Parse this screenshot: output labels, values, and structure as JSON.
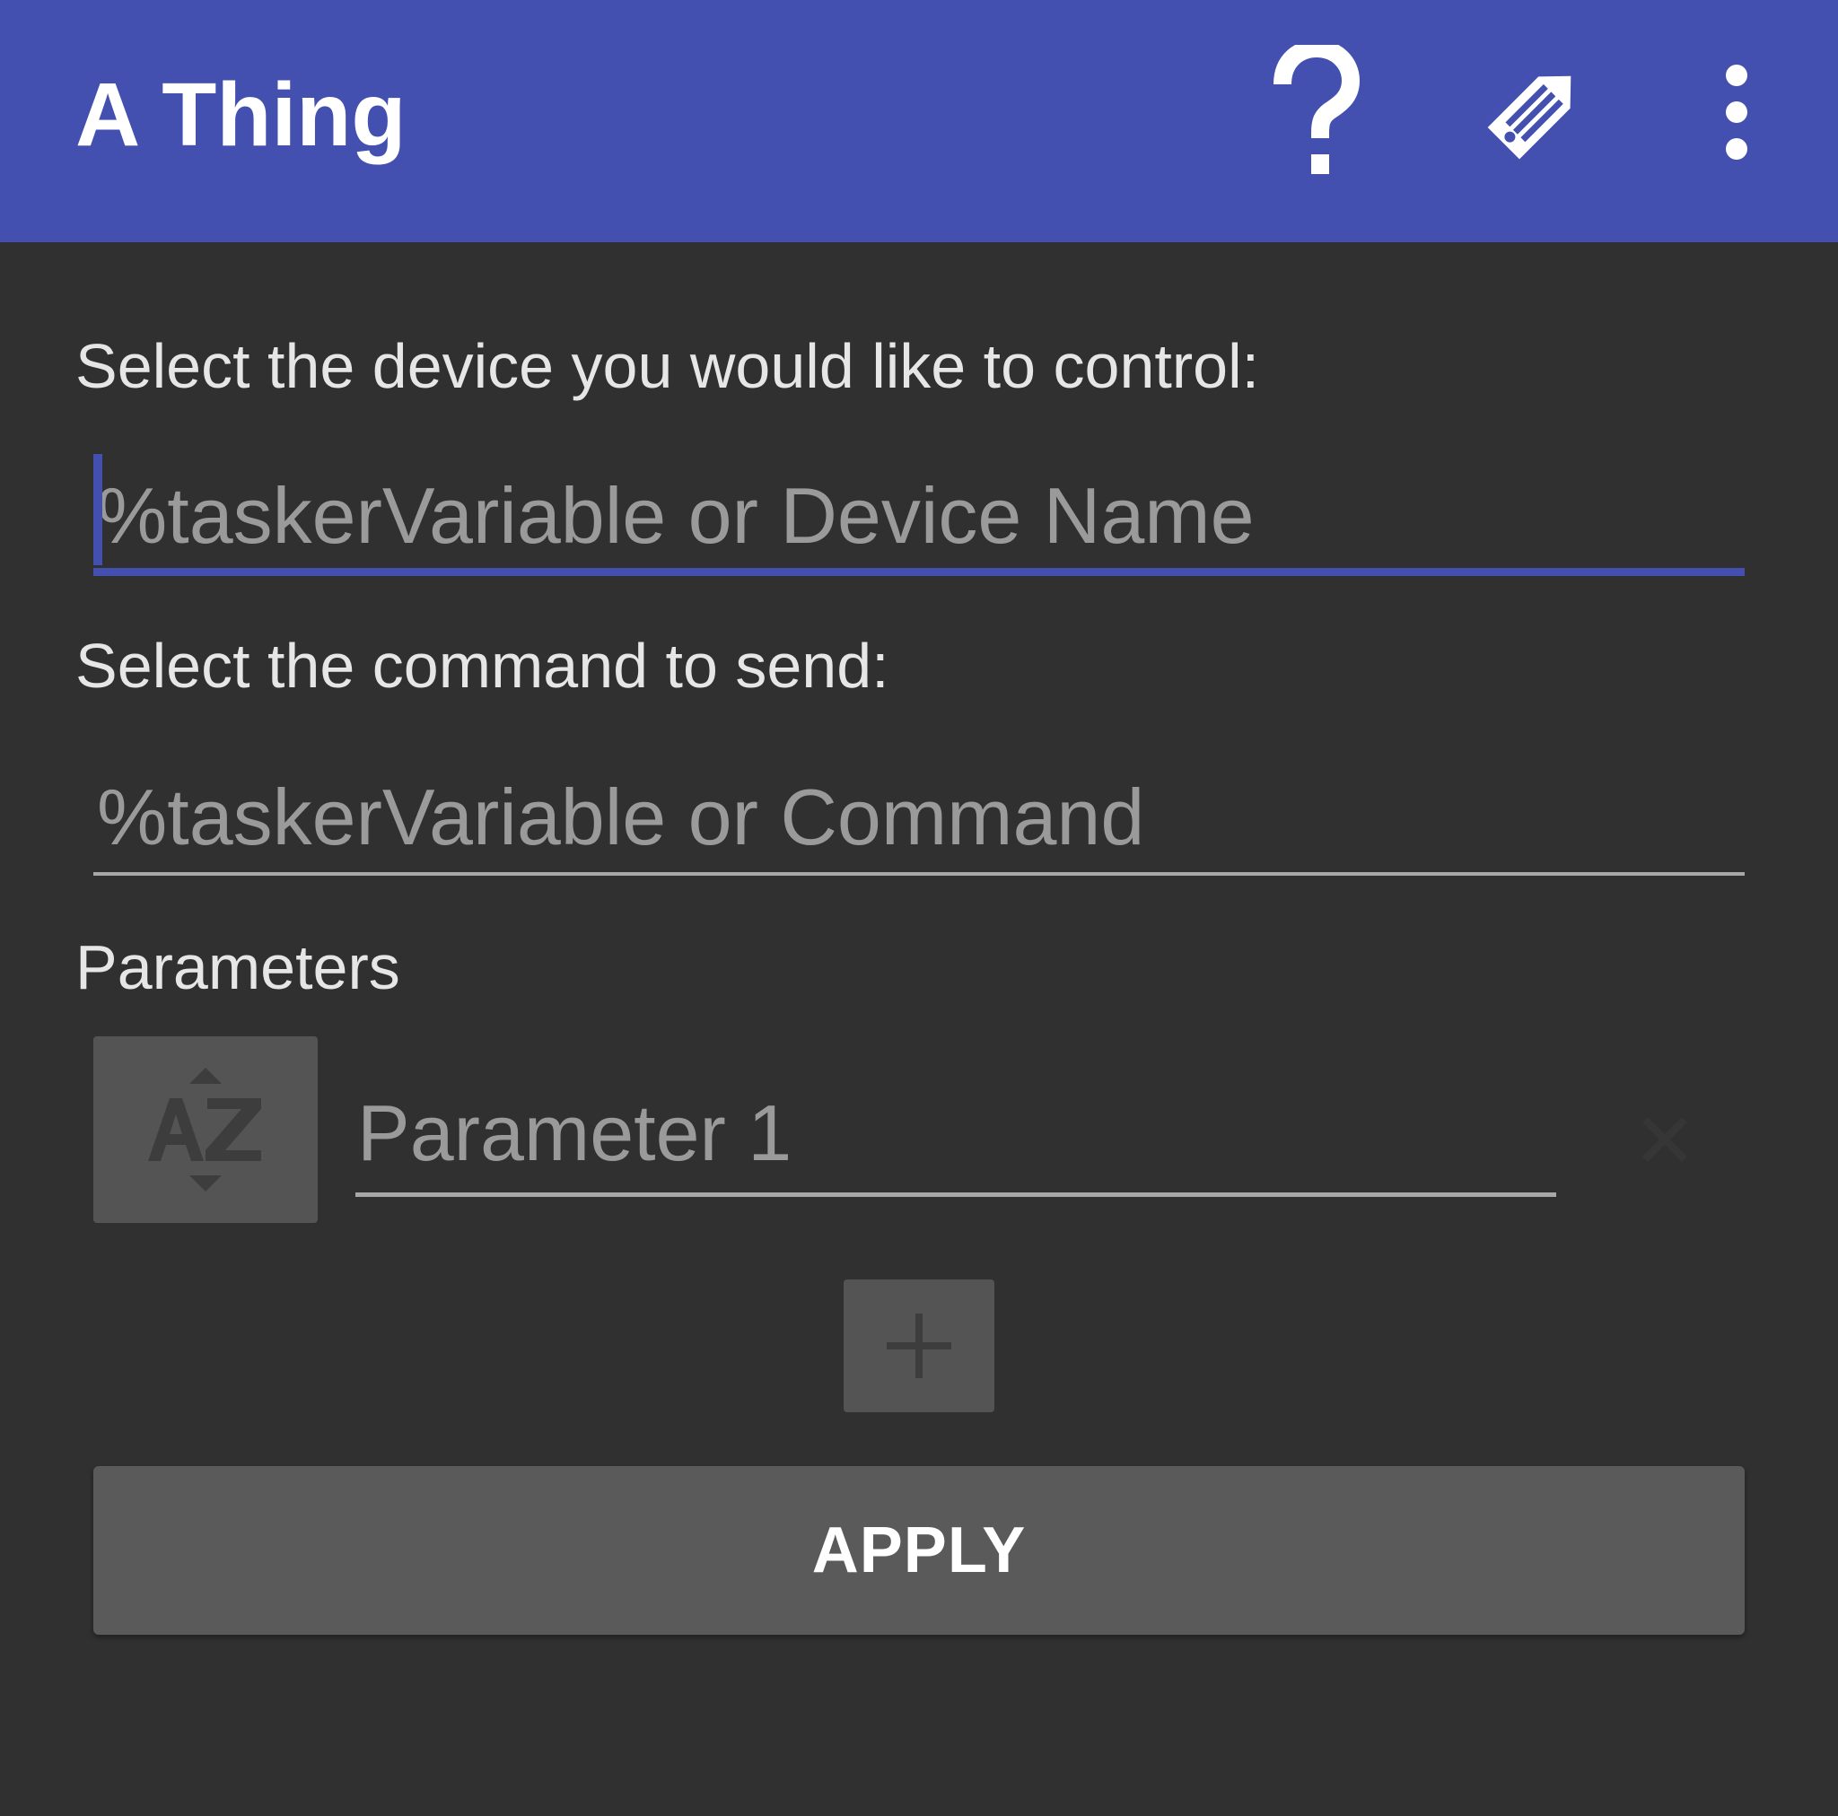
{
  "toolbar": {
    "title": "A Thing",
    "background_color": "#4350AF",
    "actions": [
      {
        "icon": "help-icon"
      },
      {
        "icon": "edit-icon"
      },
      {
        "icon": "more-vert-icon"
      }
    ]
  },
  "device": {
    "label": "Select the device you would like to control:",
    "placeholder": "%taskerVariable or Device Name",
    "value": ""
  },
  "command": {
    "label": "Select the command to send:",
    "placeholder": "%taskerVariable or Command",
    "value": ""
  },
  "parameters": {
    "label": "Parameters",
    "items": [
      {
        "placeholder": "Parameter 1",
        "value": "",
        "sort_icon": "az-sort-icon"
      }
    ],
    "add_icon": "plus-icon"
  },
  "apply": {
    "label": "APPLY"
  },
  "colors": {
    "background": "#303030",
    "accent": "#4350AF",
    "label_text": "#e6e6e6",
    "hint_text": "#9a9a9a"
  }
}
